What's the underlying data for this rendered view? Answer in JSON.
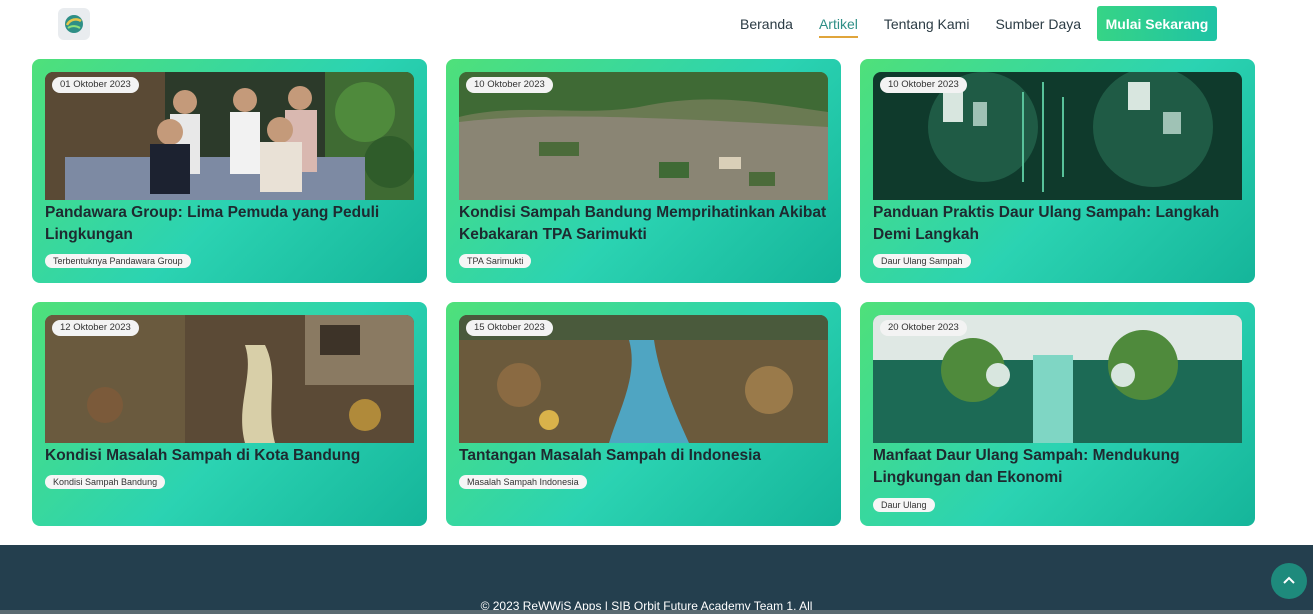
{
  "nav": {
    "logo_icon": "recycle-globe-logo",
    "links": [
      "Beranda",
      "Artikel",
      "Tentang Kami",
      "Sumber Daya"
    ],
    "active": "Artikel",
    "cta": "Mulai Sekarang"
  },
  "articles": [
    {
      "date": "01 Oktober 2023",
      "title": "Pandawara Group: Lima Pemuda yang Peduli Lingkungan",
      "tag": "Terbentuknya Pandawara Group"
    },
    {
      "date": "10 Oktober 2023",
      "title": "Kondisi Sampah Bandung Memprihatinkan Akibat Kebakaran TPA Sarimukti",
      "tag": "TPA Sarimukti"
    },
    {
      "date": "10 Oktober 2023",
      "title": "Panduan Praktis Daur Ulang Sampah: Langkah Demi Langkah",
      "tag": "Daur Ulang Sampah"
    },
    {
      "date": "12 Oktober 2023",
      "title": "Kondisi Masalah Sampah di Kota Bandung",
      "tag": "Kondisi Sampah Bandung"
    },
    {
      "date": "15 Oktober 2023",
      "title": "Tantangan Masalah Sampah di Indonesia",
      "tag": "Masalah Sampah Indonesia"
    },
    {
      "date": "20 Oktober 2023",
      "title": "Manfaat Daur Ulang Sampah: Mendukung Lingkungan dan Ekonomi",
      "tag": "Daur Ulang"
    }
  ],
  "footer": {
    "copyright": "© 2023 ReWWiS Apps | SIB Orbit Future Academy Team 1. All"
  },
  "colors": {
    "card_gradient_start": "#4fe07a",
    "card_gradient_end": "#15b59a",
    "footer_bg": "#243f4e",
    "active_underline": "#e0a53b"
  }
}
